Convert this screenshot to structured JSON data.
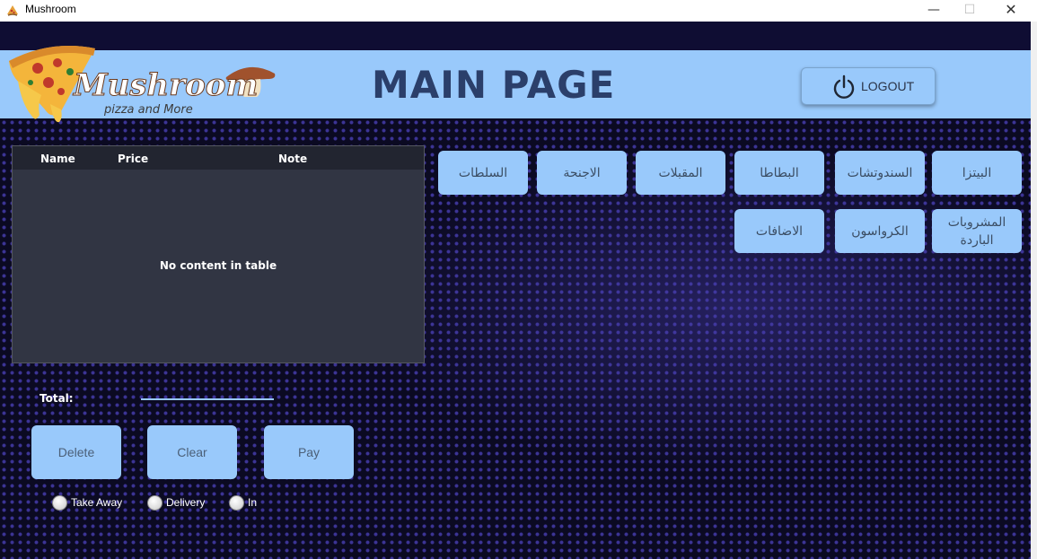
{
  "window": {
    "title": "Mushroom",
    "minimize": "—",
    "maximize": "☐",
    "close": "✕"
  },
  "header": {
    "logo_text": "Mushroom",
    "logo_tagline": "pizza and More",
    "title": "MAIN PAGE",
    "logout_label": "LOGOUT"
  },
  "table": {
    "columns": [
      "Name",
      "Price",
      "Note"
    ],
    "empty_message": "No content in table"
  },
  "categories": {
    "row1": [
      "البيتزا",
      "السندوتشات",
      "البطاطا",
      "المقبلات",
      "الاجنحة",
      "السلطات"
    ],
    "row2": [
      "المشروبات الباردة",
      "الكرواسون",
      "الاضافات"
    ]
  },
  "order": {
    "total_label": "Total:",
    "total_value": ""
  },
  "actions": {
    "delete": "Delete",
    "clear": "Clear",
    "pay": "Pay"
  },
  "order_type": {
    "options": [
      "Take Away",
      "Delivery",
      "In"
    ]
  }
}
